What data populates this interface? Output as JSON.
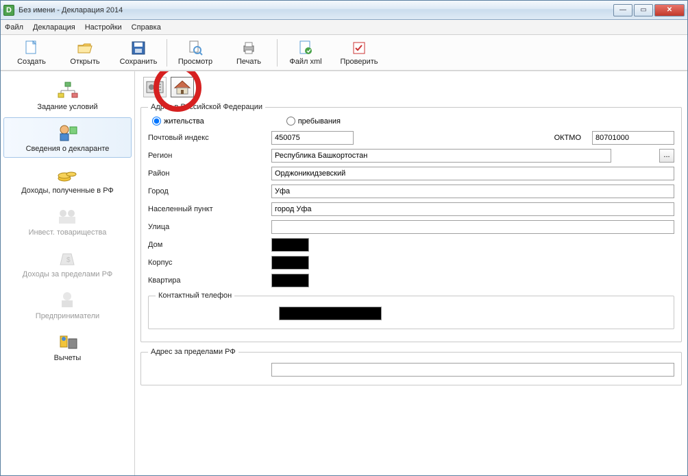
{
  "window": {
    "title": "Без имени - Декларация 2014"
  },
  "menu": {
    "file": "Файл",
    "decl": "Декларация",
    "settings": "Настройки",
    "help": "Справка"
  },
  "toolbar": {
    "create": "Создать",
    "open": "Открыть",
    "save": "Сохранить",
    "preview": "Просмотр",
    "print": "Печать",
    "xml": "Файл xml",
    "check": "Проверить"
  },
  "sidebar": {
    "items": [
      {
        "label": "Задание условий"
      },
      {
        "label": "Сведения о декларанте"
      },
      {
        "label": "Доходы, полученные в РФ"
      },
      {
        "label": "Инвест. товарищества"
      },
      {
        "label": "Доходы за пределами РФ"
      },
      {
        "label": "Предприниматели"
      },
      {
        "label": "Вычеты"
      }
    ]
  },
  "form": {
    "group_rf_title": "Адрес в Российской Федерации",
    "radio_residence": "жительства",
    "radio_stay": "пребывания",
    "postcode_label": "Почтовый индекс",
    "postcode_value": "450075",
    "oktmo_label": "ОКТМО",
    "oktmo_value": "80701000",
    "region_label": "Регион",
    "region_value": "Республика Башкортостан",
    "district_label": "Район",
    "district_value": "Орджоникидзевский",
    "city_label": "Город",
    "city_value": "Уфа",
    "locality_label": "Населенный пункт",
    "locality_value": "город Уфа",
    "street_label": "Улица",
    "house_label": "Дом",
    "building_label": "Корпус",
    "flat_label": "Квартира",
    "phone_group_title": "Контактный телефон",
    "abroad_group_title": "Адрес за пределами РФ",
    "browse_label": "..."
  }
}
